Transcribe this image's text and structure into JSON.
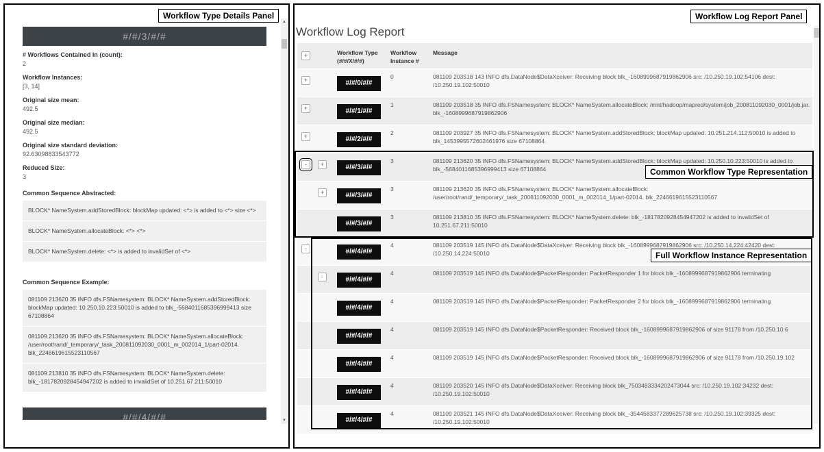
{
  "left_panel": {
    "callout": "Workflow Type Details Panel",
    "banner_1": "#/#/3/#/#",
    "properties": [
      {
        "label": "# Workflows Contained In (count):",
        "value": "2"
      },
      {
        "label": "Workflow Instances:",
        "value": "[3, 14]"
      },
      {
        "label": "Original size mean:",
        "value": "492.5"
      },
      {
        "label": "Original size median:",
        "value": "492.5"
      },
      {
        "label": "Original size standard deviation:",
        "value": "92.63098833543772"
      },
      {
        "label": "Reduced Size:",
        "value": "3"
      }
    ],
    "abstracted_label": "Common Sequence Abstracted:",
    "abstracted": [
      "BLOCK* NameSystem.addStoredBlock: blockMap updated: <*> is added to <*> size <*>",
      "BLOCK* NameSystem.allocateBlock: <*> <*>",
      "BLOCK* NameSystem.delete: <*> is added to invalidSet of <*>"
    ],
    "example_label": "Common Sequence Example:",
    "examples": [
      "081109 213620 35 INFO dfs.FSNamesystem: BLOCK* NameSystem.addStoredBlock: blockMap updated: 10.250.10.223:50010 is added to blk_-5684011685396999413 size 67108864",
      "081109 213620 35 INFO dfs.FSNamesystem: BLOCK* NameSystem.allocateBlock: /user/root/rand/_temporary/_task_200811092030_0001_m_002014_1/part-02014. blk_2246619615523110567",
      "081109 213810 35 INFO dfs.FSNamesystem: BLOCK* NameSystem.delete: blk_-1817820928454947202 is added to invalidSet of 10.251.67.211:50010"
    ],
    "banner_2": "#/#/4/#/#"
  },
  "right_panel": {
    "callout": "Workflow Log Report Panel",
    "title": "Workflow Log Report",
    "columns": {
      "type": "Workflow Type\n(#/#/X/#/#)",
      "instance": "Workflow\nInstance #",
      "message": "Message"
    },
    "annotation_common": "Common Workflow Type Representation",
    "annotation_full": "Full Workflow Instance Representation",
    "rows": [
      {
        "plus": "+",
        "tag": "#/#/0/#/#",
        "instance": "0",
        "message": "081109 203518 143 INFO dfs.DataNode$DataXceiver: Receiving block blk_-1608999687919862906 src: /10.250.19.102:54106 dest: /10.250.19.102:50010"
      },
      {
        "plus": "+",
        "tag": "#/#/1/#/#",
        "instance": "1",
        "message": "081109 203518 35 INFO dfs.FSNamesystem: BLOCK* NameSystem.allocateBlock: /mnt/hadoop/mapred/system/job_200811092030_0001/job.jar. blk_-1608999687919862906"
      },
      {
        "plus": "+",
        "tag": "#/#/2/#/#",
        "instance": "2",
        "message": "081109 203927 35 INFO dfs.FSNamesystem: BLOCK* NameSystem.addStoredBlock: blockMap updated: 10.251.214.112:50010 is added to blk_1453995572602461976 size 67108864"
      },
      {
        "minus": "-",
        "plus": "+",
        "tag": "#/#/3/#/#",
        "instance": "3",
        "message": "081109 213620 35 INFO dfs.FSNamesystem: BLOCK* NameSystem.addStoredBlock: blockMap updated: 10.250.10.223:50010 is added to blk_-5684011685396999413 size 67108864"
      },
      {
        "plus": "+",
        "tag": "#/#/3/#/#",
        "instance": "3",
        "message": "081109 213620 35 INFO dfs.FSNamesystem: BLOCK* NameSystem.allocateBlock: /user/root/rand/_temporary/_task_200811092030_0001_m_002014_1/part-02014. blk_2246619615523110567"
      },
      {
        "tag": "#/#/3/#/#",
        "instance": "3",
        "message": "081109 213810 35 INFO dfs.FSNamesystem: BLOCK* NameSystem.delete: blk_-1817820928454947202 is added to invalidSet of 10.251.67.211:50010"
      },
      {
        "minus": "-",
        "tag": "#/#/4/#/#",
        "instance": "4",
        "message": "081109 203519 145 INFO dfs.DataNode$DataXceiver: Receiving block blk_-1608999687919862906 src: /10.250.14.224:42420 dest: /10.250.14.224:50010"
      },
      {
        "minus": "-",
        "tag": "#/#/4/#/#",
        "instance": "4",
        "message": "081109 203519 145 INFO dfs.DataNode$PacketResponder: PacketResponder 1 for block blk_-1608999687919862906 terminating"
      },
      {
        "tag": "#/#/4/#/#",
        "instance": "4",
        "message": "081109 203519 145 INFO dfs.DataNode$PacketResponder: PacketResponder 2 for block blk_-1608999687919862906 terminating"
      },
      {
        "tag": "#/#/4/#/#",
        "instance": "4",
        "message": "081109 203519 145 INFO dfs.DataNode$PacketResponder: Received block blk_-1608999687919862906 of size 91178 from /10.250.10.6"
      },
      {
        "tag": "#/#/4/#/#",
        "instance": "4",
        "message": "081109 203519 145 INFO dfs.DataNode$PacketResponder: Received block blk_-1608999687919862906 of size 91178 from /10.250.19.102"
      },
      {
        "tag": "#/#/4/#/#",
        "instance": "4",
        "message": "081109 203520 145 INFO dfs.DataNode$DataXceiver: Receiving block blk_7503483334202473044 src: /10.250.19.102:34232 dest: /10.250.19.102:50010"
      },
      {
        "tag": "#/#/4/#/#",
        "instance": "4",
        "message": "081109 203521 145 INFO dfs.DataNode$DataXceiver: Receiving block blk_-3544583377289625738 src: /10.250.19.102:39325 dest: /10.250.19.102:50010"
      }
    ]
  }
}
